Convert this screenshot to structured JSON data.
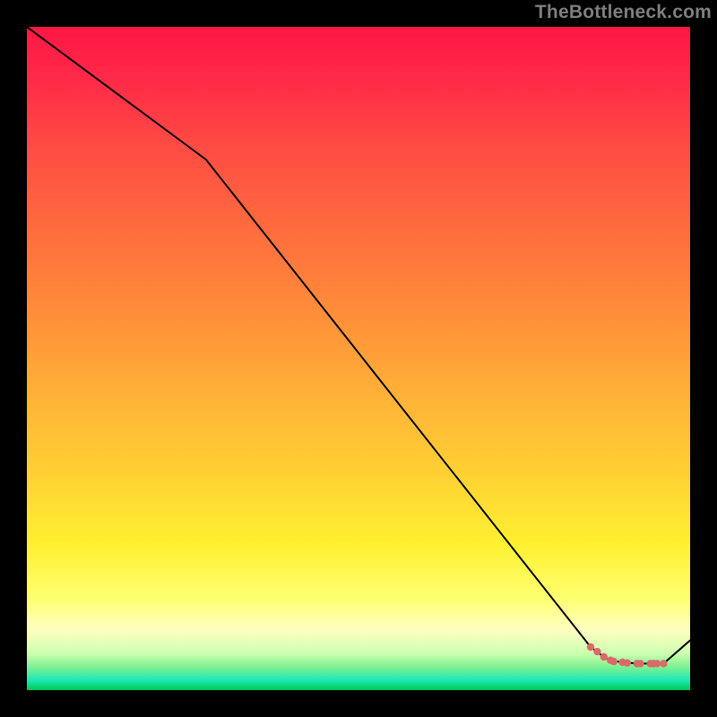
{
  "watermark": "TheBottleneck.com",
  "chart_data": {
    "type": "line",
    "title": "",
    "xlabel": "",
    "ylabel": "",
    "xlim": [
      0,
      100
    ],
    "ylim": [
      0,
      100
    ],
    "grid": false,
    "series": [
      {
        "name": "curve",
        "color": "#000000",
        "x": [
          0,
          27,
          85,
          87,
          88,
          89,
          90,
          91,
          92,
          93,
          94,
          95,
          96,
          100
        ],
        "values": [
          100,
          80,
          6.5,
          5.0,
          4.5,
          4.3,
          4.2,
          4.1,
          4.0,
          4.0,
          4.0,
          4.0,
          4.0,
          7.5
        ]
      }
    ],
    "markers": {
      "name": "highlight",
      "color": "#d96a6a",
      "x": [
        85.0,
        86.0,
        87.0,
        88.0,
        88.5,
        89.8,
        90.5,
        92.0,
        92.5,
        94.0,
        94.5,
        95.0,
        96.0
      ],
      "values": [
        6.5,
        5.8,
        5.0,
        4.5,
        4.3,
        4.2,
        4.1,
        4.0,
        4.0,
        4.0,
        4.0,
        4.0,
        4.0
      ]
    },
    "gradient_stops": [
      {
        "offset": 0.0,
        "color": "#ff1744"
      },
      {
        "offset": 0.08,
        "color": "#ff2a48"
      },
      {
        "offset": 0.18,
        "color": "#ff4b44"
      },
      {
        "offset": 0.3,
        "color": "#ff6a3e"
      },
      {
        "offset": 0.42,
        "color": "#ff8a3a"
      },
      {
        "offset": 0.55,
        "color": "#ffb037"
      },
      {
        "offset": 0.68,
        "color": "#ffd233"
      },
      {
        "offset": 0.78,
        "color": "#fff030"
      },
      {
        "offset": 0.86,
        "color": "#ffff70"
      },
      {
        "offset": 0.91,
        "color": "#feffc0"
      },
      {
        "offset": 0.945,
        "color": "#ccffb0"
      },
      {
        "offset": 0.965,
        "color": "#7ff090"
      },
      {
        "offset": 0.985,
        "color": "#1de9b6"
      },
      {
        "offset": 1.0,
        "color": "#00c853"
      }
    ]
  }
}
